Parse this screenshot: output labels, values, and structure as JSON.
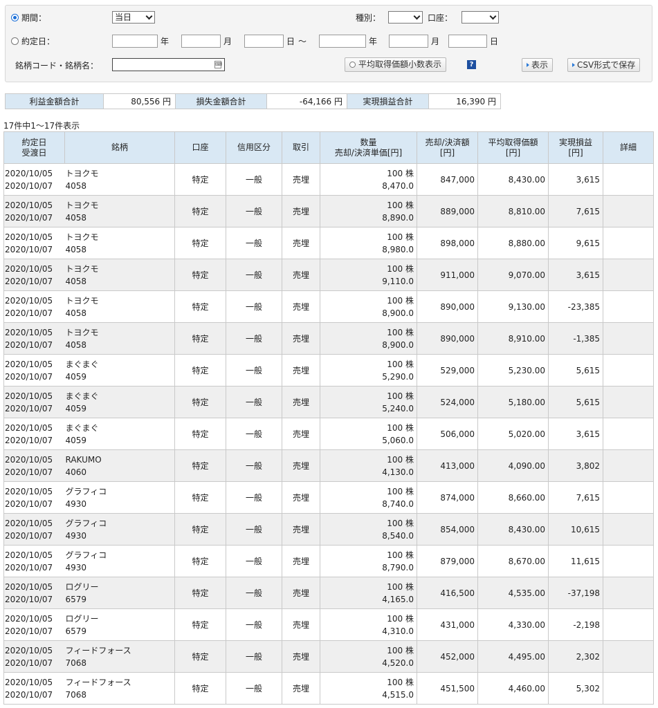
{
  "search": {
    "period_label": "期間：",
    "period_value": "当日",
    "kind_label": "種別：",
    "kind_value": "",
    "account_label": "口座：",
    "account_value": "",
    "contract_label": "約定日：",
    "year": "年",
    "month": "月",
    "day": "日",
    "tilde": "～",
    "code_label": "銘柄コード・銘柄名：",
    "code_value": "",
    "avg_btn": "平均取得価額小数表示",
    "help": "?",
    "show_btn": "表示",
    "csv_btn": "CSV形式で保存"
  },
  "totals": {
    "profit_label": "利益金額合計",
    "profit_value": "80,556 円",
    "loss_label": "損失金額合計",
    "loss_value": "-64,166 円",
    "realized_label": "実現損益合計",
    "realized_value": "16,390 円"
  },
  "count_text": "17件中1～17件表示",
  "columns": {
    "date1": "約定日",
    "date2": "受渡日",
    "name": "銘柄",
    "account": "口座",
    "credit": "信用区分",
    "trade": "取引",
    "qty1": "数量",
    "qty2": "売却/決済単価[円]",
    "amount1": "売却/決済額",
    "amount2": "[円]",
    "avg1": "平均取得価額",
    "avg2": "[円]",
    "pl1": "実現損益",
    "pl2": "[円]",
    "detail": "詳細"
  },
  "rows": [
    {
      "d1": "2020/10/05",
      "d2": "2020/10/07",
      "name": "トヨクモ",
      "code": "4058",
      "acct": "特定",
      "credit": "一般",
      "trade": "売埋",
      "qty": "100 株",
      "price": "8,470.0",
      "amount": "847,000",
      "avg": "8,430.00",
      "pl": "3,615"
    },
    {
      "d1": "2020/10/05",
      "d2": "2020/10/07",
      "name": "トヨクモ",
      "code": "4058",
      "acct": "特定",
      "credit": "一般",
      "trade": "売埋",
      "qty": "100 株",
      "price": "8,890.0",
      "amount": "889,000",
      "avg": "8,810.00",
      "pl": "7,615"
    },
    {
      "d1": "2020/10/05",
      "d2": "2020/10/07",
      "name": "トヨクモ",
      "code": "4058",
      "acct": "特定",
      "credit": "一般",
      "trade": "売埋",
      "qty": "100 株",
      "price": "8,980.0",
      "amount": "898,000",
      "avg": "8,880.00",
      "pl": "9,615"
    },
    {
      "d1": "2020/10/05",
      "d2": "2020/10/07",
      "name": "トヨクモ",
      "code": "4058",
      "acct": "特定",
      "credit": "一般",
      "trade": "売埋",
      "qty": "100 株",
      "price": "9,110.0",
      "amount": "911,000",
      "avg": "9,070.00",
      "pl": "3,615"
    },
    {
      "d1": "2020/10/05",
      "d2": "2020/10/07",
      "name": "トヨクモ",
      "code": "4058",
      "acct": "特定",
      "credit": "一般",
      "trade": "売埋",
      "qty": "100 株",
      "price": "8,900.0",
      "amount": "890,000",
      "avg": "9,130.00",
      "pl": "-23,385"
    },
    {
      "d1": "2020/10/05",
      "d2": "2020/10/07",
      "name": "トヨクモ",
      "code": "4058",
      "acct": "特定",
      "credit": "一般",
      "trade": "売埋",
      "qty": "100 株",
      "price": "8,900.0",
      "amount": "890,000",
      "avg": "8,910.00",
      "pl": "-1,385"
    },
    {
      "d1": "2020/10/05",
      "d2": "2020/10/07",
      "name": "まぐまぐ",
      "code": "4059",
      "acct": "特定",
      "credit": "一般",
      "trade": "売埋",
      "qty": "100 株",
      "price": "5,290.0",
      "amount": "529,000",
      "avg": "5,230.00",
      "pl": "5,615"
    },
    {
      "d1": "2020/10/05",
      "d2": "2020/10/07",
      "name": "まぐまぐ",
      "code": "4059",
      "acct": "特定",
      "credit": "一般",
      "trade": "売埋",
      "qty": "100 株",
      "price": "5,240.0",
      "amount": "524,000",
      "avg": "5,180.00",
      "pl": "5,615"
    },
    {
      "d1": "2020/10/05",
      "d2": "2020/10/07",
      "name": "まぐまぐ",
      "code": "4059",
      "acct": "特定",
      "credit": "一般",
      "trade": "売埋",
      "qty": "100 株",
      "price": "5,060.0",
      "amount": "506,000",
      "avg": "5,020.00",
      "pl": "3,615"
    },
    {
      "d1": "2020/10/05",
      "d2": "2020/10/07",
      "name": "RAKUMO",
      "code": "4060",
      "acct": "特定",
      "credit": "一般",
      "trade": "売埋",
      "qty": "100 株",
      "price": "4,130.0",
      "amount": "413,000",
      "avg": "4,090.00",
      "pl": "3,802"
    },
    {
      "d1": "2020/10/05",
      "d2": "2020/10/07",
      "name": "グラフィコ",
      "code": "4930",
      "acct": "特定",
      "credit": "一般",
      "trade": "売埋",
      "qty": "100 株",
      "price": "8,740.0",
      "amount": "874,000",
      "avg": "8,660.00",
      "pl": "7,615"
    },
    {
      "d1": "2020/10/05",
      "d2": "2020/10/07",
      "name": "グラフィコ",
      "code": "4930",
      "acct": "特定",
      "credit": "一般",
      "trade": "売埋",
      "qty": "100 株",
      "price": "8,540.0",
      "amount": "854,000",
      "avg": "8,430.00",
      "pl": "10,615"
    },
    {
      "d1": "2020/10/05",
      "d2": "2020/10/07",
      "name": "グラフィコ",
      "code": "4930",
      "acct": "特定",
      "credit": "一般",
      "trade": "売埋",
      "qty": "100 株",
      "price": "8,790.0",
      "amount": "879,000",
      "avg": "8,670.00",
      "pl": "11,615"
    },
    {
      "d1": "2020/10/05",
      "d2": "2020/10/07",
      "name": "ログリー",
      "code": "6579",
      "acct": "特定",
      "credit": "一般",
      "trade": "売埋",
      "qty": "100 株",
      "price": "4,165.0",
      "amount": "416,500",
      "avg": "4,535.00",
      "pl": "-37,198"
    },
    {
      "d1": "2020/10/05",
      "d2": "2020/10/07",
      "name": "ログリー",
      "code": "6579",
      "acct": "特定",
      "credit": "一般",
      "trade": "売埋",
      "qty": "100 株",
      "price": "4,310.0",
      "amount": "431,000",
      "avg": "4,330.00",
      "pl": "-2,198"
    },
    {
      "d1": "2020/10/05",
      "d2": "2020/10/07",
      "name": "フィードフォース",
      "code": "7068",
      "acct": "特定",
      "credit": "一般",
      "trade": "売埋",
      "qty": "100 株",
      "price": "4,520.0",
      "amount": "452,000",
      "avg": "4,495.00",
      "pl": "2,302"
    },
    {
      "d1": "2020/10/05",
      "d2": "2020/10/07",
      "name": "フィードフォース",
      "code": "7068",
      "acct": "特定",
      "credit": "一般",
      "trade": "売埋",
      "qty": "100 株",
      "price": "4,515.0",
      "amount": "451,500",
      "avg": "4,460.00",
      "pl": "5,302"
    }
  ]
}
